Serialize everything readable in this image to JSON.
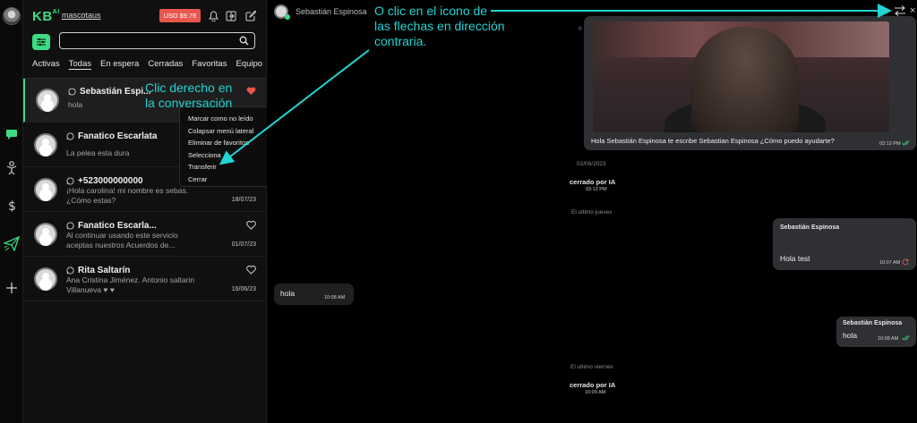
{
  "rail": {
    "icons": [
      "globe-avatar",
      "chat-icon",
      "person-icon",
      "dollar-icon",
      "send-icon",
      "plus-icon"
    ]
  },
  "topbar": {
    "logo": "KB",
    "logo_suffix": "AI",
    "store_name": "mascotaus",
    "balance": "USD $9.78"
  },
  "search": {
    "placeholder": "",
    "value": ""
  },
  "tabs": [
    "Activas",
    "Todas",
    "En espera",
    "Cerradas",
    "Favoritas",
    "Equipo"
  ],
  "active_tab": "Todas",
  "conversations": [
    {
      "name": "Sebastián Espi...",
      "preview": "hola",
      "date": "",
      "favorite": true
    },
    {
      "name": "Fanatico Escarlata",
      "preview": "La pelea esta dura",
      "date": "",
      "favorite": false
    },
    {
      "name": "+523000000000",
      "preview": "¡Hola carolina! mi nombre es sebas. ¿Cómo estas?",
      "preview_l1": "¡Hola carolina! mi nombre es sebas.",
      "preview_l2": "¿Cómo estas?",
      "date": "18/07/23",
      "favorite": false
    },
    {
      "name": "Fanatico Escarla...",
      "preview_l1": "Al continuar usando este servicio",
      "preview_l2": "aceptas nuestros Acuerdos de...",
      "date": "01/07/23",
      "favorite": false
    },
    {
      "name": "Rita Saltarín",
      "preview_l1": "Ana Cristina Jiménez. Antonio saltarin",
      "preview_l2": "Villanueva ♥ ♥",
      "date": "16/06/23",
      "favorite": false
    }
  ],
  "context_menu": [
    "Marcar como no leído",
    "Colapsar menú lateral",
    "Eliminar de favoritos",
    "Selecciona",
    "Transferir",
    "Cerrar"
  ],
  "chat": {
    "contact_name": "Sebastián Espinosa",
    "messages": {
      "media_caption": "Hola Sebastián Espinosa te escribe Sebastian Espinosa ¿Cómo puedo ayudarte?",
      "media_time": "03:12 PM",
      "date1": "02/09/2023",
      "closed1": "cerrado por IA",
      "closed1_time": "03:12 PM",
      "date2": "El ultimo jueves",
      "out1_sender": "Sebastián Espinosa",
      "out1_text": "Hola test",
      "out1_time": "10:07 AM",
      "in1_text": "hola",
      "in1_time": "10:08 AM",
      "out2_sender": "Sebastián Espinosa",
      "out2_text": "hola",
      "out2_time": "10:08 AM",
      "date3": "El ultimo viernes",
      "closed2": "cerrado por IA",
      "closed2_time": "10:09 AM",
      "top_date_partial": "0"
    }
  },
  "annotations": {
    "right_click": "Clic derecho en la conversación",
    "right_click_l1": "Clic derecho en",
    "right_click_l2": "la conversación",
    "arrows_l1": "O clic en el icono de",
    "arrows_l2": "las flechas en dirección",
    "arrows_l3": "contraria."
  },
  "colors": {
    "accent": "#3ddc84",
    "balance_badge": "#e8574e",
    "annotation": "#22d3d3",
    "bubble": "#2f3034",
    "favorite_heart": "#e8574e"
  }
}
